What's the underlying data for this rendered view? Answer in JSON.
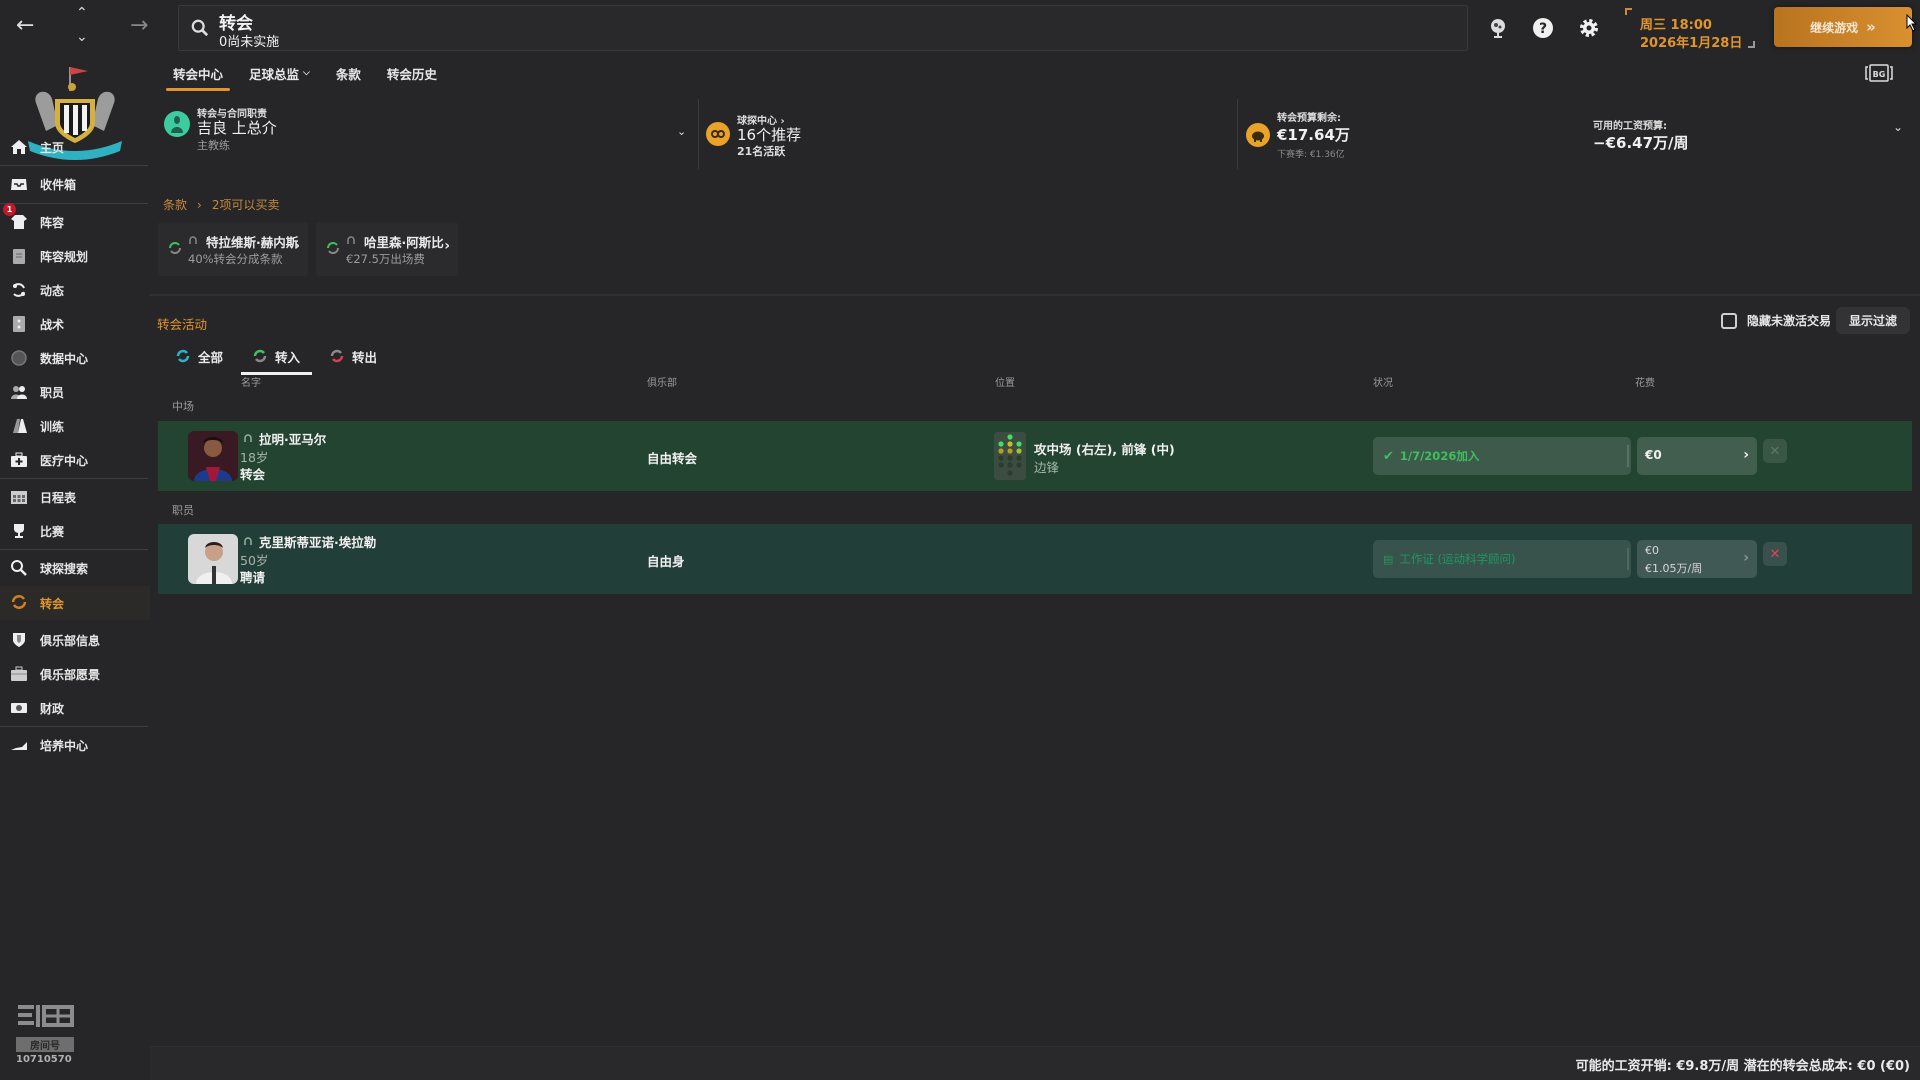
{
  "topbar": {
    "search_title": "转会",
    "search_subtitle": "0尚未实施",
    "date_line1": "周三 18:00",
    "date_line2": "2026年1月28日",
    "continue_label": "继续游戏",
    "continue_icon": "»"
  },
  "sidebar": {
    "inbox_badge": "1",
    "items": [
      {
        "label": "主页",
        "icon": "home-icon"
      },
      {
        "label": "收件箱",
        "icon": "inbox-icon"
      },
      {
        "label": "阵容",
        "icon": "shirt-icon"
      },
      {
        "label": "阵容规划",
        "icon": "clipboard-icon"
      },
      {
        "label": "动态",
        "icon": "dynamics-icon"
      },
      {
        "label": "战术",
        "icon": "tactics-board-icon"
      },
      {
        "label": "数据中心",
        "icon": "data-hub-icon"
      },
      {
        "label": "职员",
        "icon": "staff-icon"
      },
      {
        "label": "训练",
        "icon": "training-cone-icon"
      },
      {
        "label": "医疗中心",
        "icon": "medical-kit-icon"
      },
      {
        "label": "日程表",
        "icon": "calendar-icon"
      },
      {
        "label": "比赛",
        "icon": "trophy-icon"
      },
      {
        "label": "球探搜索",
        "icon": "search-icon"
      },
      {
        "label": "转会",
        "icon": "transfer-icon"
      },
      {
        "label": "俱乐部信息",
        "icon": "shield-icon"
      },
      {
        "label": "俱乐部愿景",
        "icon": "briefcase-icon"
      },
      {
        "label": "财政",
        "icon": "money-icon"
      },
      {
        "label": "培养中心",
        "icon": "development-icon"
      }
    ],
    "watermark_label": "房间号",
    "watermark_number": "10710570"
  },
  "tabs": [
    {
      "label": "转会中心",
      "active": true
    },
    {
      "label": "足球总监",
      "dropdown": true
    },
    {
      "label": "条款"
    },
    {
      "label": "转会历史"
    }
  ],
  "info": {
    "responsibility_label": "转会与合同职责",
    "responsibility_name": "吉良 上总介",
    "responsibility_role": "主教练",
    "scouting_label": "球探中心",
    "scouting_value": "16个推荐",
    "scouting_sub": "21名活跃",
    "budget_label": "转会预算剩余:",
    "budget_value": "€17.64万",
    "budget_next": "下赛季: €1.36亿",
    "wage_label": "可用的工资预算:",
    "wage_value": "−€6.47万/周"
  },
  "clauses": {
    "breadcrumb_root": "条款",
    "breadcrumb_count": "2项可以买卖",
    "cards": [
      {
        "name": "特拉维斯·赫内斯",
        "desc": "40%转会分成条款"
      },
      {
        "name": "哈里森·阿斯比",
        "desc": "€27.5万出场费"
      }
    ]
  },
  "activity": {
    "title": "转会活动",
    "hide_inactive_label": "隐藏未激活交易",
    "hide_inactive_checked": false,
    "filter_label": "显示过滤",
    "subtabs": [
      {
        "label": "全部",
        "color": "#2bb3c9"
      },
      {
        "label": "转入",
        "color": "#3fc25b",
        "active": true
      },
      {
        "label": "转出",
        "color": "#d9404d"
      }
    ],
    "columns": {
      "name": "名字",
      "club": "俱乐部",
      "position": "位置",
      "status": "状况",
      "fee": "花费"
    },
    "groups": [
      {
        "label": "中场",
        "rows": [
          {
            "name": "拉明·亚马尔",
            "age": "18岁",
            "type": "转会",
            "club": "自由转会",
            "position": "攻中场 (右左), 前锋 (中)",
            "position_sub": "边锋",
            "status": "1/7/2026加入",
            "fee": "€0",
            "fee_wage": ""
          }
        ]
      },
      {
        "label": "职员",
        "rows": [
          {
            "name": "克里斯蒂亚诺·埃拉勒",
            "age": "50岁",
            "type": "聘请",
            "club": "自由身",
            "position": "",
            "position_sub": "",
            "status": "工作证 (运动科学顾问)",
            "fee": "€0",
            "fee_wage": "€1.05万/周"
          }
        ]
      }
    ]
  },
  "footer": {
    "summary": "可能的工资开销: €9.8万/周 潜在的转会总成本: €0 (€0)"
  },
  "colors": {
    "accent": "#e0952e",
    "row_player": "#244432",
    "row_staff": "#223e38",
    "status_green": "#3fbf5f",
    "cancel_red": "#e8405a"
  }
}
